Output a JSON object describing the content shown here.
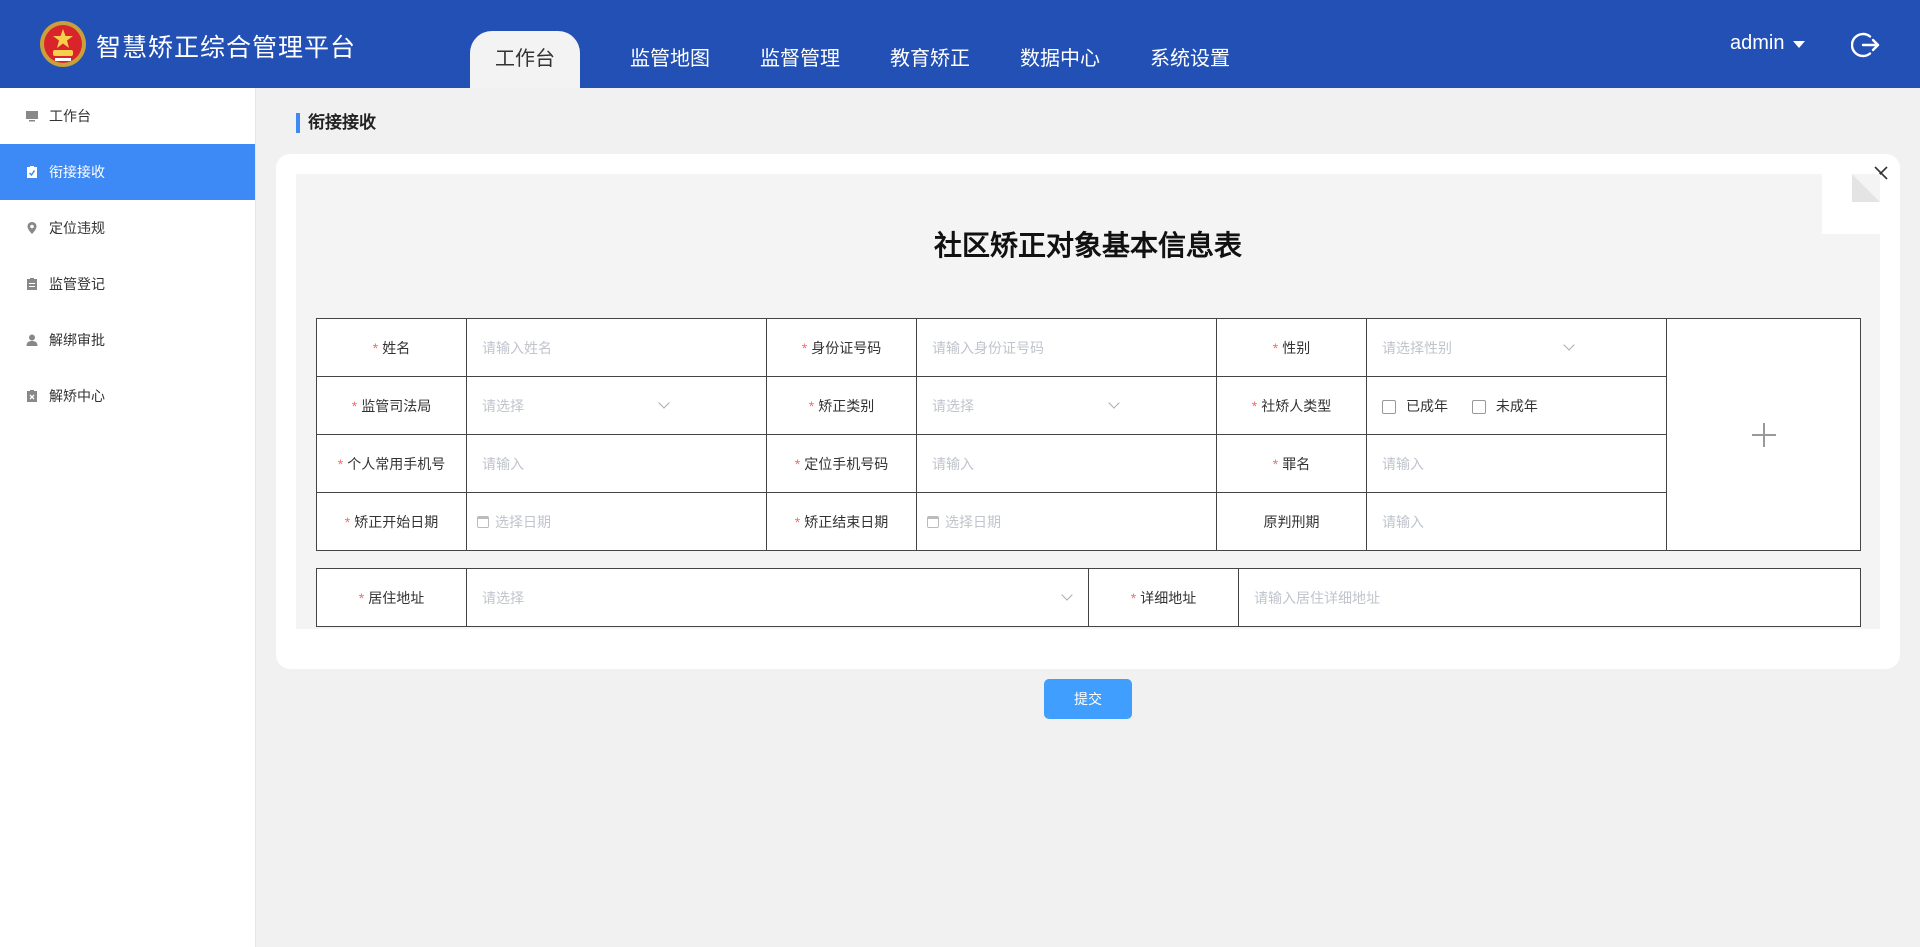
{
  "header": {
    "app_title": "智慧矫正综合管理平台",
    "nav": [
      "工作台",
      "监管地图",
      "监督管理",
      "教育矫正",
      "数据中心",
      "系统设置"
    ],
    "active_nav": 0,
    "user": "admin",
    "accent_color": "#2350b4"
  },
  "sidebar": {
    "items": [
      {
        "label": "工作台",
        "icon": "monitor-icon"
      },
      {
        "label": "衔接接收",
        "icon": "clipboard-check-icon"
      },
      {
        "label": "定位违规",
        "icon": "location-pin-icon"
      },
      {
        "label": "监管登记",
        "icon": "clipboard-icon"
      },
      {
        "label": "解绑审批",
        "icon": "user-icon"
      },
      {
        "label": "解矫中心",
        "icon": "clipboard-x-icon"
      }
    ],
    "active": 1,
    "active_color": "#3d8af7"
  },
  "breadcrumb": "衔接接收",
  "form": {
    "title": "社区矫正对象基本信息表",
    "name_label": "姓名",
    "name_ph": "请输入姓名",
    "id_label": "身份证号码",
    "id_ph": "请输入身份证号码",
    "gender_label": "性别",
    "gender_ph": "请选择性别",
    "bureau_label": "监管司法局",
    "bureau_ph": "请选择",
    "category_label": "矫正类别",
    "category_ph": "请选择",
    "persontype_label": "社矫人类型",
    "adult_label": "已成年",
    "minor_label": "未成年",
    "phone_label": "个人常用手机号",
    "phone_ph": "请输入",
    "locphone_label": "定位手机号码",
    "locphone_ph": "请输入",
    "crime_label": "罪名",
    "crime_ph": "请输入",
    "start_label": "矫正开始日期",
    "start_ph": "选择日期",
    "end_label": "矫正结束日期",
    "end_ph": "选择日期",
    "sentence_label": "原判刑期",
    "sentence_ph": "请输入",
    "address_label": "居住地址",
    "address_ph": "请选择",
    "detail_label": "详细地址",
    "detail_ph": "请输入居住详细地址",
    "required_mark": "*"
  },
  "submit_label": "提交"
}
